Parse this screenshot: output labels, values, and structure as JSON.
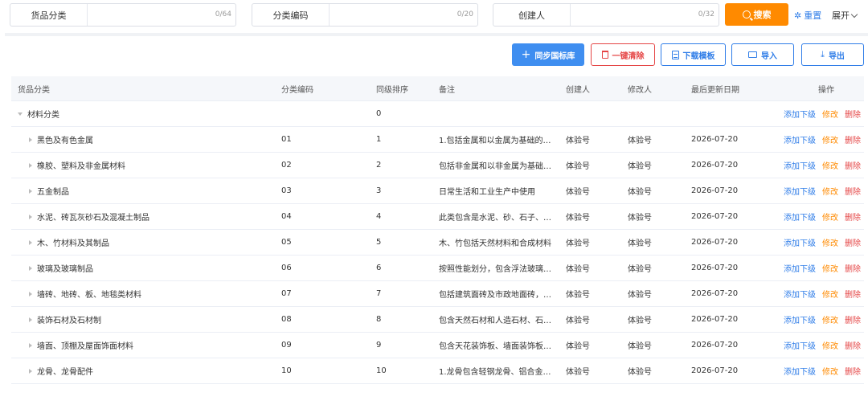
{
  "search": {
    "fields": [
      {
        "label": "货品分类",
        "count": "0/64"
      },
      {
        "label": "分类编码",
        "count": "0/20"
      },
      {
        "label": "创建人",
        "count": "0/32"
      }
    ],
    "search_label": "搜索",
    "reset_label": "重置",
    "expand_label": "展开"
  },
  "toolbar": {
    "sync_label": "同步国标库",
    "clear_label": "一键清除",
    "download_label": "下载模板",
    "import_label": "导入",
    "export_label": "导出"
  },
  "table": {
    "headers": {
      "name": "货品分类",
      "code": "分类编码",
      "sort": "同级排序",
      "note": "备注",
      "creator": "创建人",
      "modifier": "修改人",
      "updated": "最后更新日期",
      "ops": "操作"
    },
    "ops": {
      "add": "添加下级",
      "edit": "修改",
      "del": "删除"
    },
    "parent": {
      "name": "材料分类",
      "code": "",
      "sort": "0",
      "note": "",
      "creator": "",
      "modifier": "",
      "updated": ""
    },
    "rows": [
      {
        "name": "黑色及有色金属",
        "code": "01",
        "sort": "1",
        "note": "1.包括金属和以金属为基础的…",
        "creator": "体验号",
        "modifier": "体验号",
        "updated": "2026-07-20"
      },
      {
        "name": "橡胶、塑料及非金属材料",
        "code": "02",
        "sort": "2",
        "note": "包括非金属和以非金属为基础…",
        "creator": "体验号",
        "modifier": "体验号",
        "updated": "2026-07-20"
      },
      {
        "name": "五金制品",
        "code": "03",
        "sort": "3",
        "note": "日常生活和工业生产中使用",
        "creator": "体验号",
        "modifier": "体验号",
        "updated": "2026-07-20"
      },
      {
        "name": "水泥、砖瓦灰砂石及混凝土制品",
        "code": "04",
        "sort": "4",
        "note": "此类包含是水泥、砂、石子、…",
        "creator": "体验号",
        "modifier": "体验号",
        "updated": "2026-07-20"
      },
      {
        "name": "木、竹材料及其制品",
        "code": "05",
        "sort": "5",
        "note": "木、竹包括天然材料和合成材料",
        "creator": "体验号",
        "modifier": "体验号",
        "updated": "2026-07-20"
      },
      {
        "name": "玻璃及玻璃制品",
        "code": "06",
        "sort": "6",
        "note": "按照性能划分，包含浮法玻璃…",
        "creator": "体验号",
        "modifier": "体验号",
        "updated": "2026-07-20"
      },
      {
        "name": "墙砖、地砖、板、地毯类材料",
        "code": "07",
        "sort": "7",
        "note": "包括建筑面砖及市政地面砖，…",
        "creator": "体验号",
        "modifier": "体验号",
        "updated": "2026-07-20"
      },
      {
        "name": "装饰石材及石材制",
        "code": "08",
        "sort": "8",
        "note": "包含天然石材和人造石材、石…",
        "creator": "体验号",
        "modifier": "体验号",
        "updated": "2026-07-20"
      },
      {
        "name": "墙面、顶棚及屋面饰面材料",
        "code": "09",
        "sort": "9",
        "note": "包含天花装饰板、墙面装饰板…",
        "creator": "体验号",
        "modifier": "体验号",
        "updated": "2026-07-20"
      },
      {
        "name": "龙骨、龙骨配件",
        "code": "10",
        "sort": "10",
        "note": "1.龙骨包含轻钢龙骨、铝合金…",
        "creator": "体验号",
        "modifier": "体验号",
        "updated": "2026-07-20"
      }
    ]
  }
}
